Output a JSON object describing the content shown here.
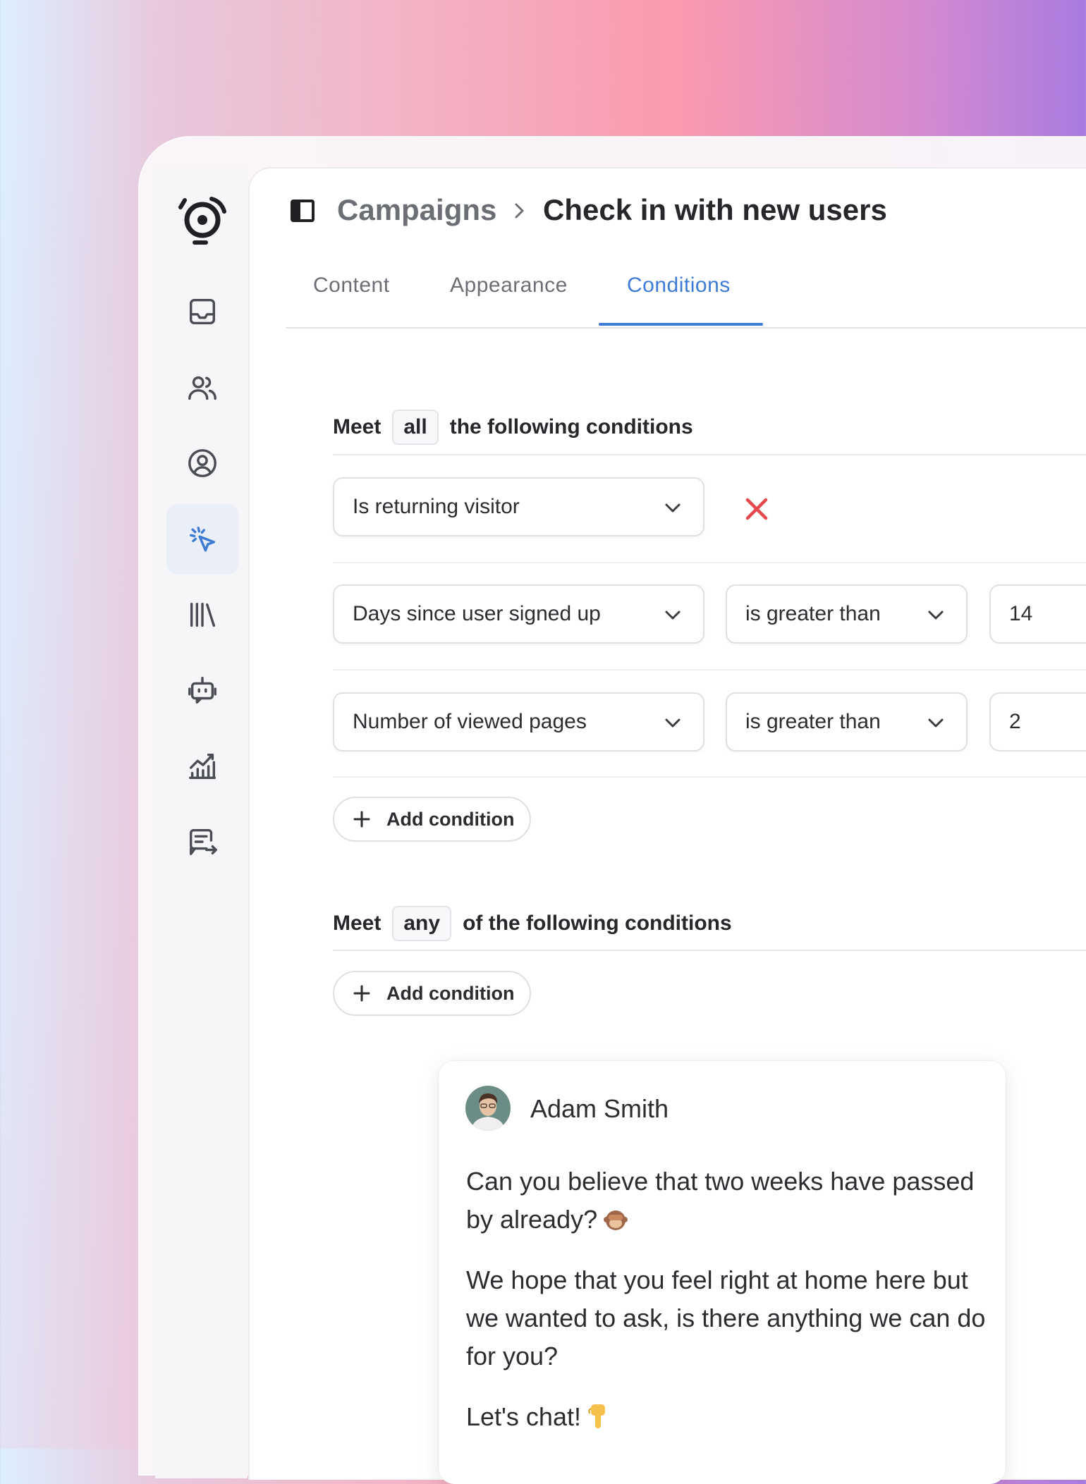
{
  "breadcrumb": {
    "parent": "Campaigns",
    "current": "Check in with new users"
  },
  "tabs": [
    {
      "label": "Content",
      "active": false
    },
    {
      "label": "Appearance",
      "active": false
    },
    {
      "label": "Conditions",
      "active": true
    }
  ],
  "sidebar": {
    "items": [
      {
        "icon": "inbox-icon"
      },
      {
        "icon": "users-icon"
      },
      {
        "icon": "user-circle-icon"
      },
      {
        "icon": "cursor-click-icon",
        "active": true
      },
      {
        "icon": "library-icon"
      },
      {
        "icon": "bot-icon"
      },
      {
        "icon": "analytics-icon"
      },
      {
        "icon": "message-forward-icon"
      }
    ]
  },
  "all_group": {
    "prefix": "Meet",
    "quantifier": "all",
    "suffix": "the following conditions",
    "conditions": [
      {
        "field": "Is returning visitor"
      },
      {
        "field": "Days since user signed up",
        "operator": "is greater than",
        "value": "14"
      },
      {
        "field": "Number of viewed pages",
        "operator": "is greater than",
        "value": "2"
      }
    ],
    "add_label": "Add condition"
  },
  "any_group": {
    "prefix": "Meet",
    "quantifier": "any",
    "suffix": "of the following conditions",
    "add_label": "Add condition"
  },
  "message": {
    "author": "Adam Smith",
    "paragraph1": "Can you believe that two weeks have passed by already?",
    "paragraph2": "We hope that you feel right at home here but we wanted to ask, is there anything we can do for you?",
    "paragraph3": "Let's chat!"
  },
  "colors": {
    "accent": "#3e7bd4",
    "remove": "#e5484d",
    "text": "#25272b",
    "muted": "#6b6e75"
  }
}
